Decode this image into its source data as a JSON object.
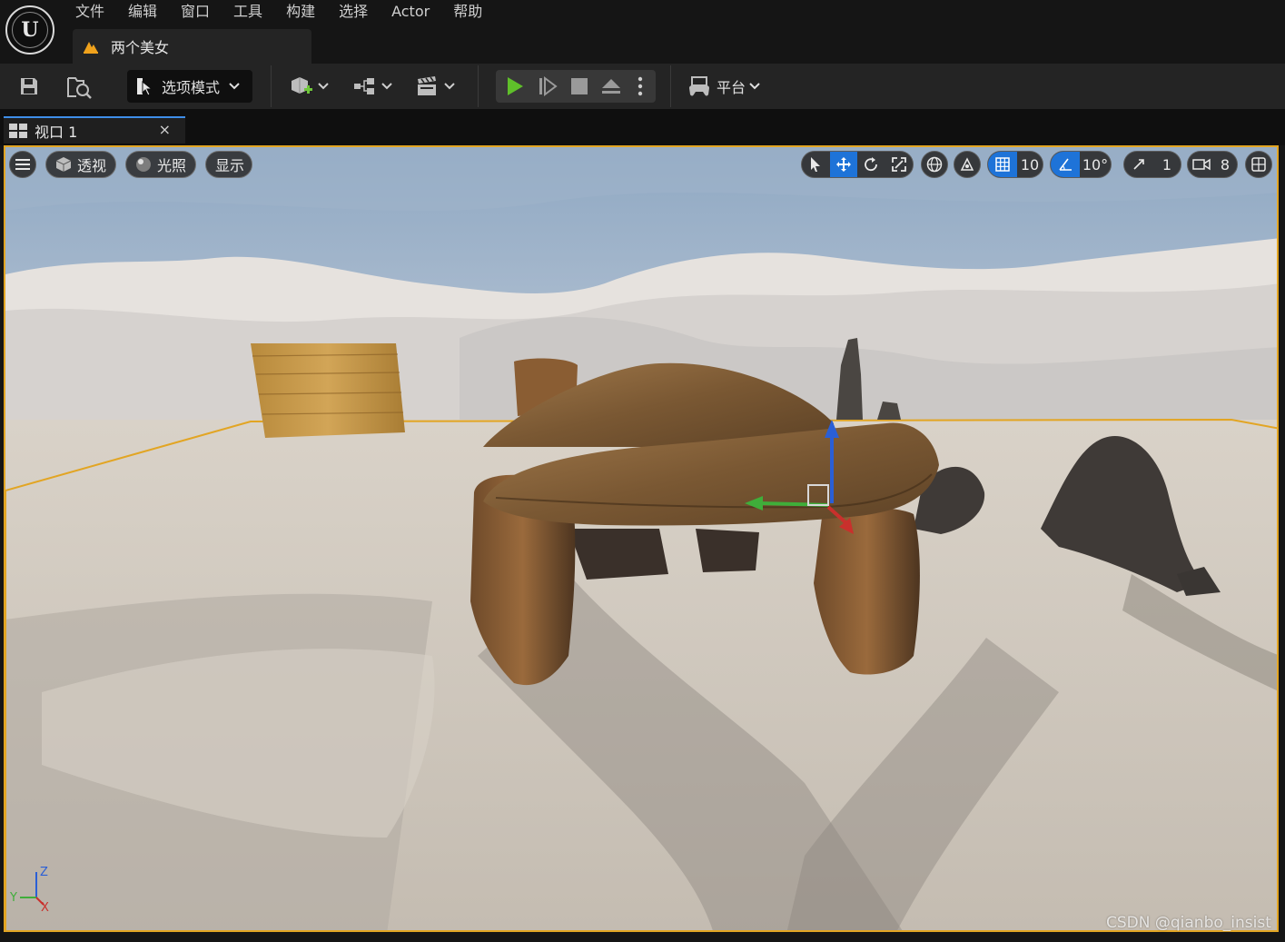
{
  "app": {
    "logo": "unreal-engine-logo",
    "menu": [
      "文件",
      "编辑",
      "窗口",
      "工具",
      "构建",
      "选择",
      "Actor",
      "帮助"
    ],
    "level_name": "两个美女"
  },
  "toolbar": {
    "mode_label": "选项模式",
    "platform_label": "平台",
    "icons": [
      "save-icon",
      "content-browser-icon",
      "add-actor-icon",
      "blueprint-icon",
      "cinematics-icon",
      "play-icon",
      "step-icon",
      "stop-icon",
      "eject-icon",
      "more-icon",
      "platform-icon"
    ],
    "play_color": "#5fbf2a"
  },
  "viewport_tab": {
    "label": "视口 1",
    "close": "×"
  },
  "viewport": {
    "view_mode": "透视",
    "lit_mode": "光照",
    "show_label": "显示",
    "grid_snap": "10",
    "rotation_snap": "10°",
    "scale_snap": "1",
    "camera_speed": "8",
    "selection_color": "#e2a523",
    "active_color": "#1e73d8",
    "axis_labels": {
      "z": "Z",
      "y": "Y",
      "x": "X"
    }
  },
  "watermark": "CSDN @qianbo_insist"
}
